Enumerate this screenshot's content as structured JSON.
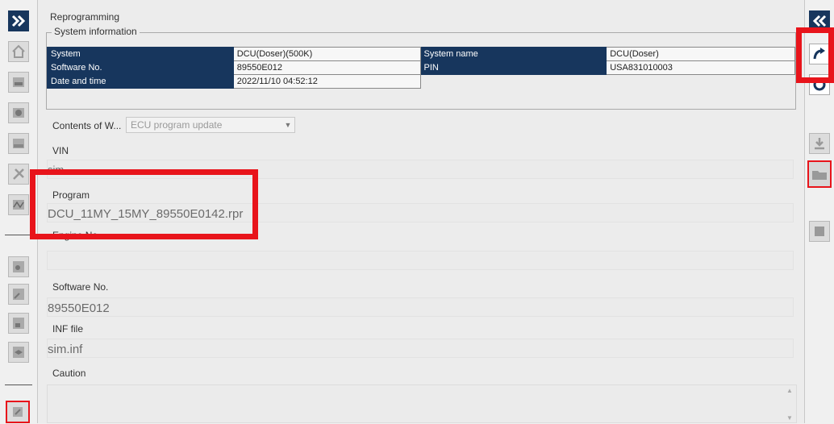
{
  "page": {
    "title": "Reprogramming"
  },
  "system_info": {
    "legend": "System information",
    "rows": [
      {
        "label": "System",
        "value": "DCU(Doser)(500K)",
        "label2": "System name",
        "value2": "DCU(Doser)"
      },
      {
        "label": "Software No.",
        "value": "89550E012",
        "label2": "PIN",
        "value2": "USA831010003"
      },
      {
        "label": "Date and time",
        "value": "2022/11/10 04:52:12"
      }
    ]
  },
  "contents": {
    "label": "Contents of W...",
    "selected": "ECU program update"
  },
  "fields": {
    "vin": {
      "label": "VIN",
      "value": "sim"
    },
    "program": {
      "label": "Program",
      "value": "DCU_11MY_15MY_89550E0142.rpr"
    },
    "engine": {
      "label": "Engine No.",
      "value": ""
    },
    "software": {
      "label": "Software No.",
      "value": "89550E012"
    },
    "inf": {
      "label": "INF file",
      "value": "sim.inf"
    },
    "caution": {
      "label": "Caution",
      "value": ""
    }
  },
  "icons": {
    "left": [
      "expand-icon",
      "home-icon",
      "sys-icon",
      "dtc-icon",
      "can-icon",
      "tools-icon",
      "wave-icon",
      "settings-grid-icon",
      "edit-grid-icon",
      "lock-grid-icon",
      "graduate-grid-icon",
      "chip-grid-icon"
    ],
    "right": [
      "collapse-icon",
      "reprogram-arrow-icon",
      "reset-icon",
      "download-icon",
      "open-folder-icon",
      "chip-icon"
    ]
  },
  "colors": {
    "header_bg": "#17365d",
    "highlight": "#e8141b",
    "button_blue": "#17365d"
  }
}
